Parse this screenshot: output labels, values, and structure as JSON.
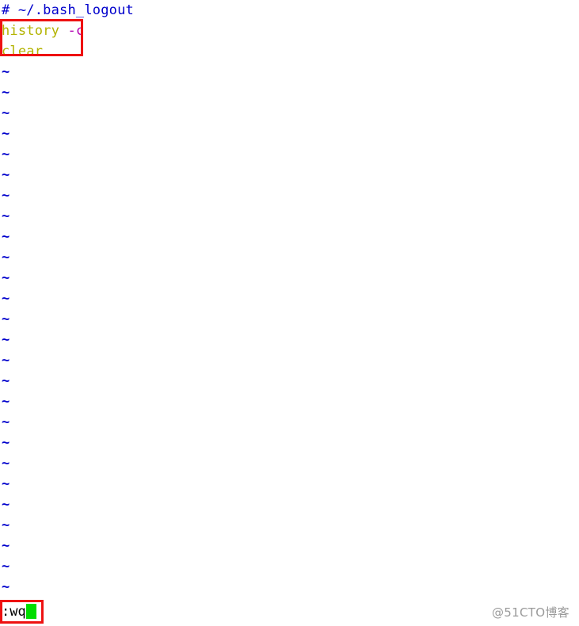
{
  "app": {
    "name": "vim",
    "background_color": "#ffffff",
    "file": "~/.bash_logout"
  },
  "buffer": {
    "lines": [
      {
        "id": "line-1",
        "text": "# ~/.bash_logout",
        "type": "comment",
        "color": "#0000cc"
      },
      {
        "id": "line-2",
        "text": "history",
        "flag": " -c",
        "type": "command",
        "color": "#b3b300",
        "flag_color": "#b300b3"
      },
      {
        "id": "line-3",
        "text": "clear",
        "flag": "",
        "type": "command",
        "color": "#b3b300",
        "flag_color": "#b300b3"
      }
    ],
    "empty_marker": "~",
    "empty_marker_color": "#0000cc",
    "empty_marker_count": 26
  },
  "annotations": [
    {
      "id": "annotation-commands",
      "label": "red-highlight-commands",
      "color": "#ee1111"
    },
    {
      "id": "annotation-exit-command",
      "label": "red-highlight-exit-command",
      "color": "#ee1111"
    }
  ],
  "status": {
    "command_text": ":wq",
    "cursor": "block",
    "cursor_color": "#00dd00",
    "text_color": "#000000"
  },
  "watermark": {
    "text": "@51CTO博客",
    "color": "#9a9a9a"
  }
}
